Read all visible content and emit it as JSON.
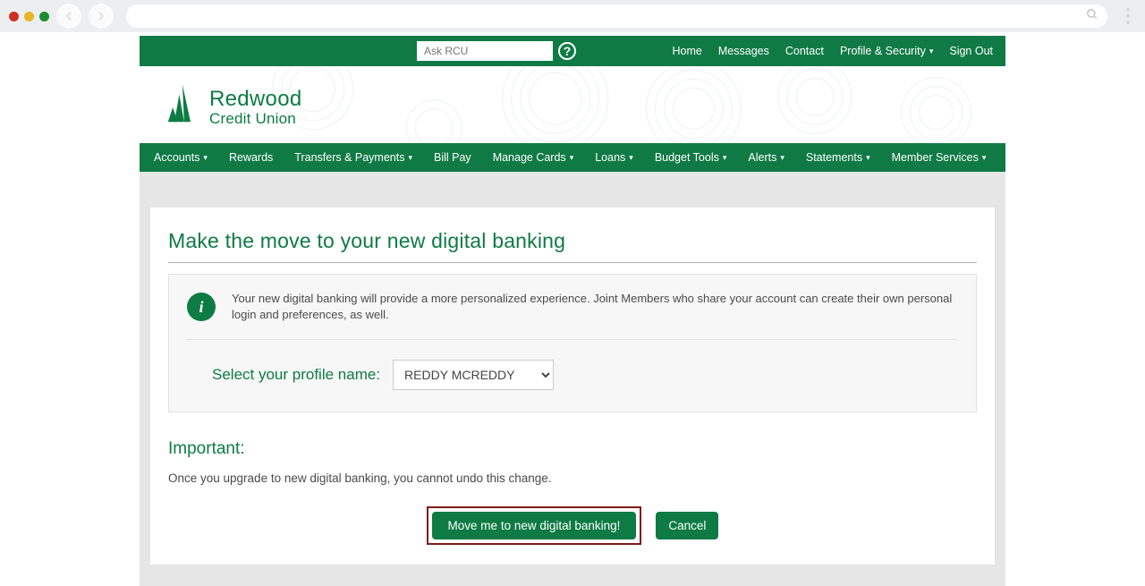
{
  "browser": {
    "url": ""
  },
  "utilNav": {
    "ask_placeholder": "Ask RCU",
    "links": {
      "home": "Home",
      "messages": "Messages",
      "contact": "Contact",
      "profile_security": "Profile & Security",
      "sign_out": "Sign Out"
    }
  },
  "brand": {
    "line1": "Redwood",
    "line2": "Credit Union"
  },
  "mainNav": {
    "accounts": "Accounts",
    "rewards": "Rewards",
    "transfers": "Transfers & Payments",
    "bill_pay": "Bill Pay",
    "manage_cards": "Manage Cards",
    "loans": "Loans",
    "budget_tools": "Budget Tools",
    "alerts": "Alerts",
    "statements": "Statements",
    "member_services": "Member Services"
  },
  "card": {
    "title": "Make the move to your new digital banking",
    "info_text": "Your new digital banking will provide a more personalized experience. Joint Members who share your account can create their own personal login and preferences, as well.",
    "select_label": "Select your profile name:",
    "profile_selected": "REDDY MCREDDY",
    "important_heading": "Important:",
    "important_text": "Once you upgrade to new digital banking, you cannot undo this change.",
    "primary_button": "Move me to new digital banking!",
    "cancel_button": "Cancel"
  },
  "colors": {
    "brand_green": "#0e7b44",
    "nav_green": "#107a45",
    "highlight_red": "#7e1b18"
  }
}
